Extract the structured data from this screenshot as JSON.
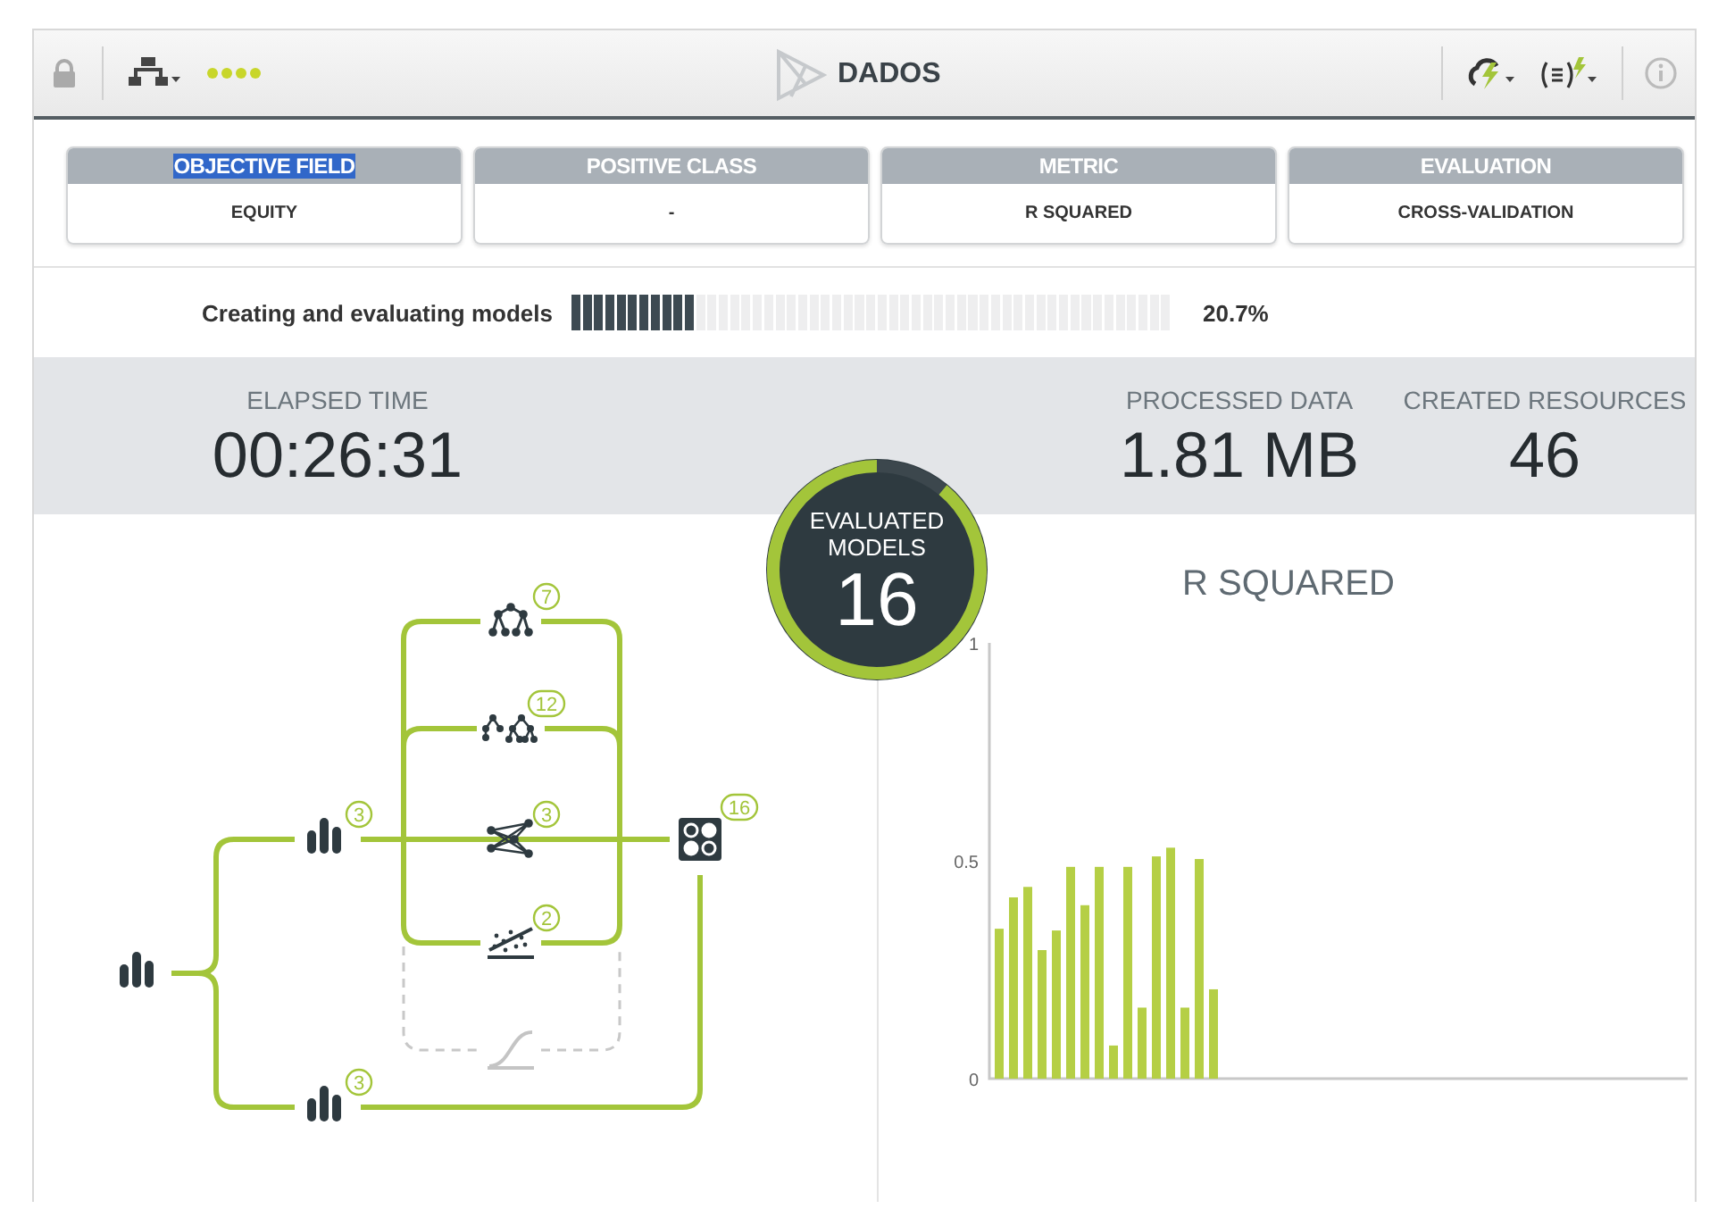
{
  "toolbar": {
    "title": "DADOS"
  },
  "cards": [
    {
      "label": "OBJECTIVE FIELD",
      "value": "EQUITY",
      "highlighted": true
    },
    {
      "label": "POSITIVE CLASS",
      "value": "-",
      "highlighted": false
    },
    {
      "label": "METRIC",
      "value": "R SQUARED",
      "highlighted": false
    },
    {
      "label": "EVALUATION",
      "value": "CROSS-VALIDATION",
      "highlighted": false
    }
  ],
  "progress": {
    "label": "Creating and evaluating models",
    "level": 0.207,
    "reading": "20.7%"
  },
  "stats": [
    {
      "label": "ELAPSED TIME",
      "value": "00:26:31"
    },
    {
      "label": "PROCESSED DATA",
      "value": "1.81 MB"
    },
    {
      "label": "CREATED RESOURCES",
      "value": "46"
    }
  ],
  "evaluated": {
    "label": "EVALUATED MODELS",
    "value": "16",
    "level": 0.89
  },
  "diagram": {
    "nodes": [
      {
        "kind": "dataset",
        "disabled": false
      },
      {
        "kind": "dataset",
        "badge": "3",
        "disabled": false
      },
      {
        "kind": "dataset",
        "badge": "3",
        "disabled": false
      },
      {
        "kind": "tree",
        "badge": "7",
        "disabled": false
      },
      {
        "kind": "ensemble",
        "badge": "12",
        "disabled": false
      },
      {
        "kind": "deepnet",
        "badge": "3",
        "disabled": false
      },
      {
        "kind": "linear",
        "badge": "2",
        "disabled": false
      },
      {
        "kind": "logistic",
        "disabled": true
      },
      {
        "kind": "evaluation",
        "badge": "16",
        "disabled": false
      }
    ]
  },
  "chart": {
    "title": "R SQUARED",
    "chart_data": {
      "type": "bar",
      "ylim": [
        0,
        1
      ],
      "yticks": [
        0,
        0.5,
        1
      ],
      "series": [
        {
          "color": "#b5cf45",
          "values": [
            0.344,
            0.416,
            0.44,
            0.295,
            0.34,
            0.486,
            0.398,
            0.486,
            0.076,
            0.486,
            0.163,
            0.51,
            0.53,
            0.163,
            0.504,
            0.205
          ]
        }
      ]
    }
  }
}
